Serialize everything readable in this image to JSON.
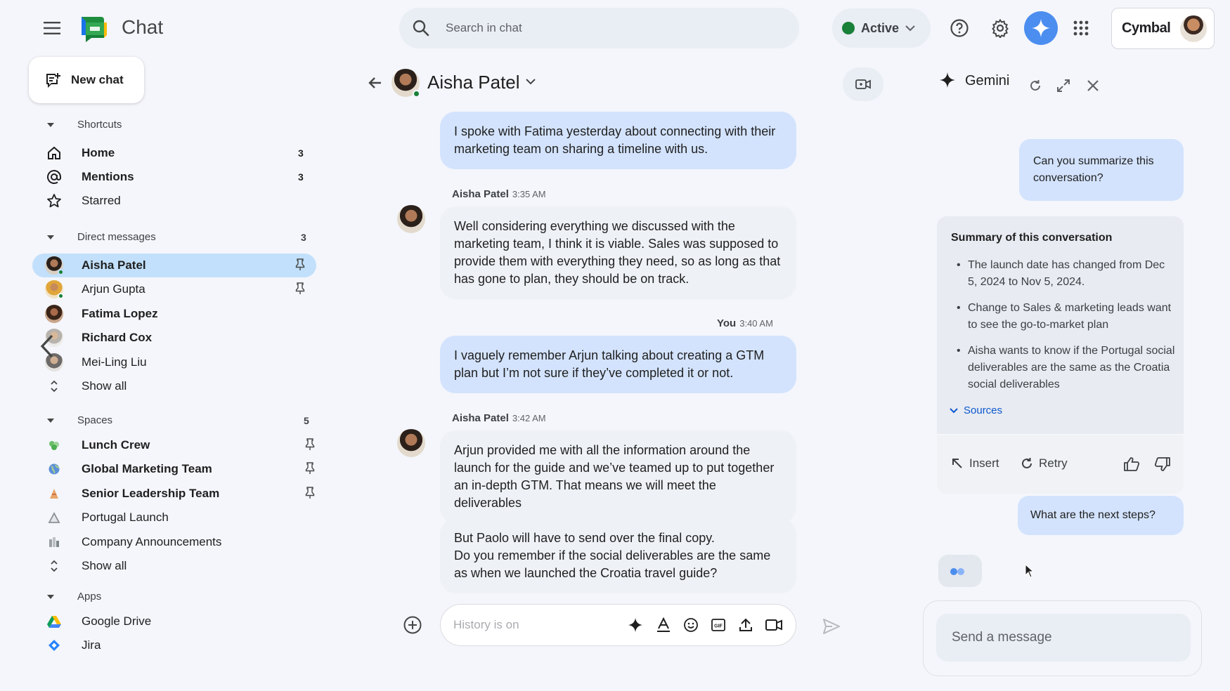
{
  "app": {
    "name": "Chat"
  },
  "search": {
    "placeholder": "Search in chat"
  },
  "status": {
    "label": "Active"
  },
  "account": {
    "org": "Cymbal"
  },
  "colors": {
    "accent": "#0b57d0",
    "selected": "#c2e0fb",
    "bubble_mine": "#d3e3fd",
    "online": "#188038"
  },
  "sidebar": {
    "new_chat": "New chat",
    "shortcuts": {
      "heading": "Shortcuts",
      "items": [
        {
          "label": "Home",
          "icon": "home-icon",
          "count": "3"
        },
        {
          "label": "Mentions",
          "icon": "at-icon",
          "count": "3"
        },
        {
          "label": "Starred",
          "icon": "star-icon",
          "count": ""
        }
      ]
    },
    "dms": {
      "heading": "Direct messages",
      "count": "3",
      "items": [
        {
          "label": "Aisha Patel"
        },
        {
          "label": "Arjun Gupta"
        },
        {
          "label": "Fatima Lopez"
        },
        {
          "label": "Richard Cox"
        },
        {
          "label": "Mei-Ling Liu"
        }
      ],
      "show_all": "Show all"
    },
    "spaces": {
      "heading": "Spaces",
      "count": "5",
      "items": [
        {
          "label": "Lunch Crew"
        },
        {
          "label": "Global Marketing Team"
        },
        {
          "label": "Senior Leadership Team"
        },
        {
          "label": "Portugal Launch"
        },
        {
          "label": "Company Announcements"
        }
      ],
      "show_all": "Show all"
    },
    "apps": {
      "heading": "Apps",
      "items": [
        {
          "label": "Google Drive"
        },
        {
          "label": "Jira"
        }
      ]
    }
  },
  "chat": {
    "title": "Aisha Patel",
    "messages": [
      {
        "text": "I spoke with Fatima yesterday about connecting with their marketing team on sharing a timeline with us."
      },
      {
        "sender": "Aisha Patel",
        "time": "3:35 AM",
        "text": "Well considering everything we discussed with the marketing team, I think it is viable. Sales was supposed to provide them with everything they need, so as long as that has gone to plan, they should be on track."
      },
      {
        "sender": "You",
        "time": "3:40 AM",
        "text": "I vaguely remember Arjun talking about creating a GTM plan but I’m not sure if they’ve completed it or not."
      },
      {
        "sender": "Aisha Patel",
        "time": "3:42 AM",
        "text": "Arjun provided me with all the information around the launch for the guide and we’ve teamed up to put together an in-depth GTM. That means we will meet the deliverables"
      },
      {
        "text1": "But Paolo will have to send over the final copy.",
        "text2": "Do you remember if the social deliverables are the same as when we launched the Croatia travel guide?"
      }
    ],
    "composer": {
      "placeholder": "History is on"
    }
  },
  "gemini": {
    "title": "Gemini",
    "prompt1": "Can you summarize this conversation?",
    "summary": {
      "heading": "Summary of this conversation",
      "bullets": [
        "The launch date has changed from Dec 5, 2024 to Nov 5, 2024.",
        "Change to Sales & marketing leads want to see the go-to-market plan",
        "Aisha wants to know if the Portugal social deliverables are the same as the Croatia social deliverables"
      ],
      "sources": "Sources"
    },
    "actions": {
      "insert": "Insert",
      "retry": "Retry"
    },
    "prompt2": "What are the next steps?",
    "input_placeholder": "Send a message"
  }
}
